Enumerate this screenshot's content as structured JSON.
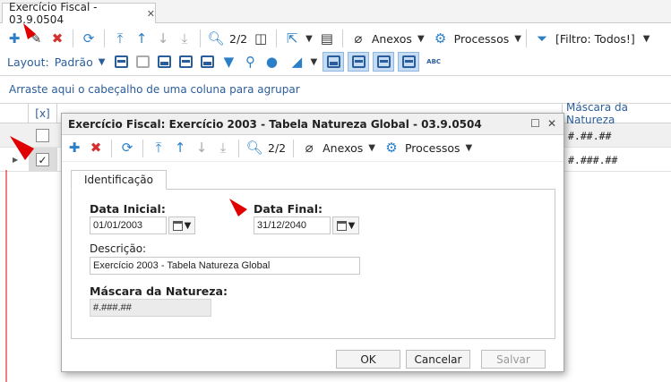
{
  "tab": {
    "title": "Exercício Fiscal - 03.9.0504",
    "close": "✕"
  },
  "toolbar": {
    "page": "2/2",
    "anexos": "Anexos",
    "processos": "Processos",
    "filter": "[Filtro: Todos!]"
  },
  "layout_bar": {
    "label": "Layout:",
    "value": "Padrão",
    "abc": "ABC"
  },
  "group_hint": "Arraste aqui o cabeçalho de uma coluna para agrupar",
  "grid": {
    "headers": {
      "select": "[x]",
      "mask": "Máscara da Natureza"
    },
    "rows": [
      {
        "checked": false,
        "mask": "#.##.##"
      },
      {
        "checked": true,
        "mask": "#.###.##"
      }
    ]
  },
  "dialog": {
    "title": "Exercício Fiscal: Exercício 2003 - Tabela Natureza Global - 03.9.0504",
    "page": "2/2",
    "anexos": "Anexos",
    "processos": "Processos",
    "tab": "Identificação",
    "fields": {
      "data_inicial_label": "Data Inicial:",
      "data_inicial_value": "01/01/2003",
      "data_final_label": "Data Final:",
      "data_final_value": "31/12/2040",
      "descricao_label": "Descrição:",
      "descricao_value": "Exercício 2003 - Tabela Natureza Global",
      "mascara_label": "Máscara da Natureza:",
      "mascara_value": "#.###.##"
    },
    "buttons": {
      "ok": "OK",
      "cancel": "Cancelar",
      "save": "Salvar"
    }
  },
  "colors": {
    "accent": "#2a7fc7",
    "danger": "#d43030",
    "link": "#2a5d9b",
    "annotation": "#e00000"
  }
}
